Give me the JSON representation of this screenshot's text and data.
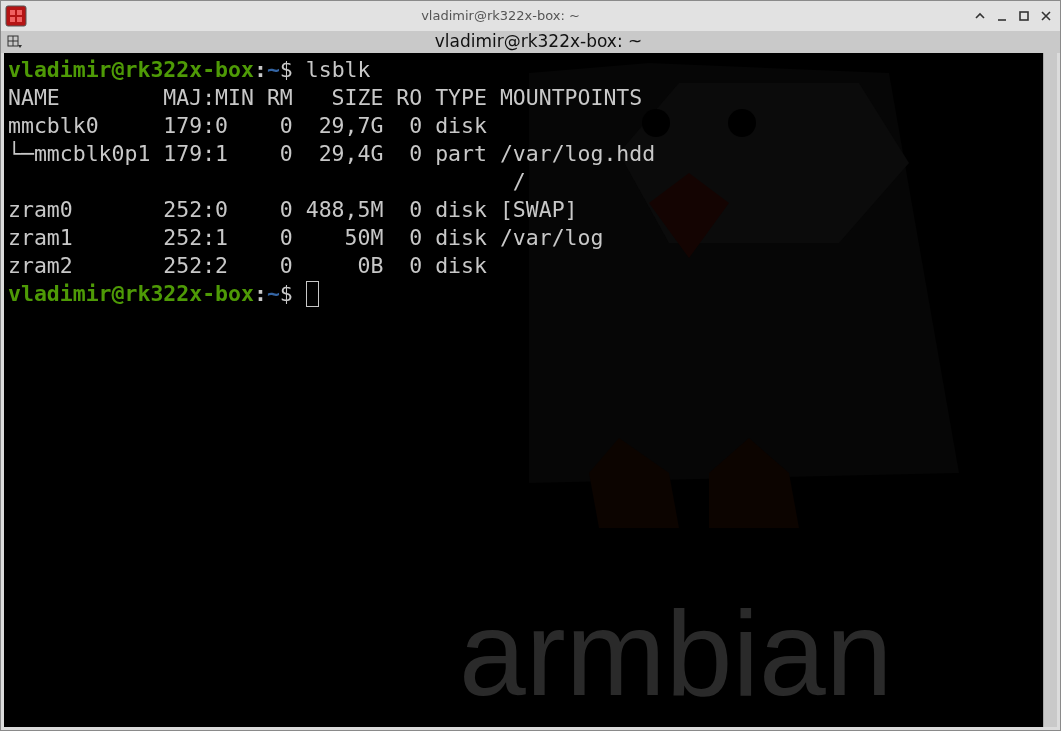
{
  "window": {
    "title": "vladimir@rk322x-box: ~"
  },
  "terminal": {
    "title": "vladimir@rk322x-box: ~",
    "background_logo_text": "armbian",
    "lines": [
      {
        "kind": "prompt",
        "user_host": "vladimir@rk322x-box",
        "separator": ":",
        "path": "~",
        "symbol": "$",
        "command": " lsblk"
      },
      {
        "kind": "output",
        "text": "NAME        MAJ:MIN RM   SIZE RO TYPE MOUNTPOINTS"
      },
      {
        "kind": "output",
        "text": "mmcblk0     179:0    0  29,7G  0 disk "
      },
      {
        "kind": "output",
        "text": "└─mmcblk0p1 179:1    0  29,4G  0 part /var/log.hdd"
      },
      {
        "kind": "output",
        "text": "                                       /"
      },
      {
        "kind": "output",
        "text": "zram0       252:0    0 488,5M  0 disk [SWAP]"
      },
      {
        "kind": "output",
        "text": "zram1       252:1    0    50M  0 disk /var/log"
      },
      {
        "kind": "output",
        "text": "zram2       252:2    0     0B  0 disk "
      },
      {
        "kind": "prompt",
        "user_host": "vladimir@rk322x-box",
        "separator": ":",
        "path": "~",
        "symbol": "$",
        "cursor": true
      }
    ]
  }
}
